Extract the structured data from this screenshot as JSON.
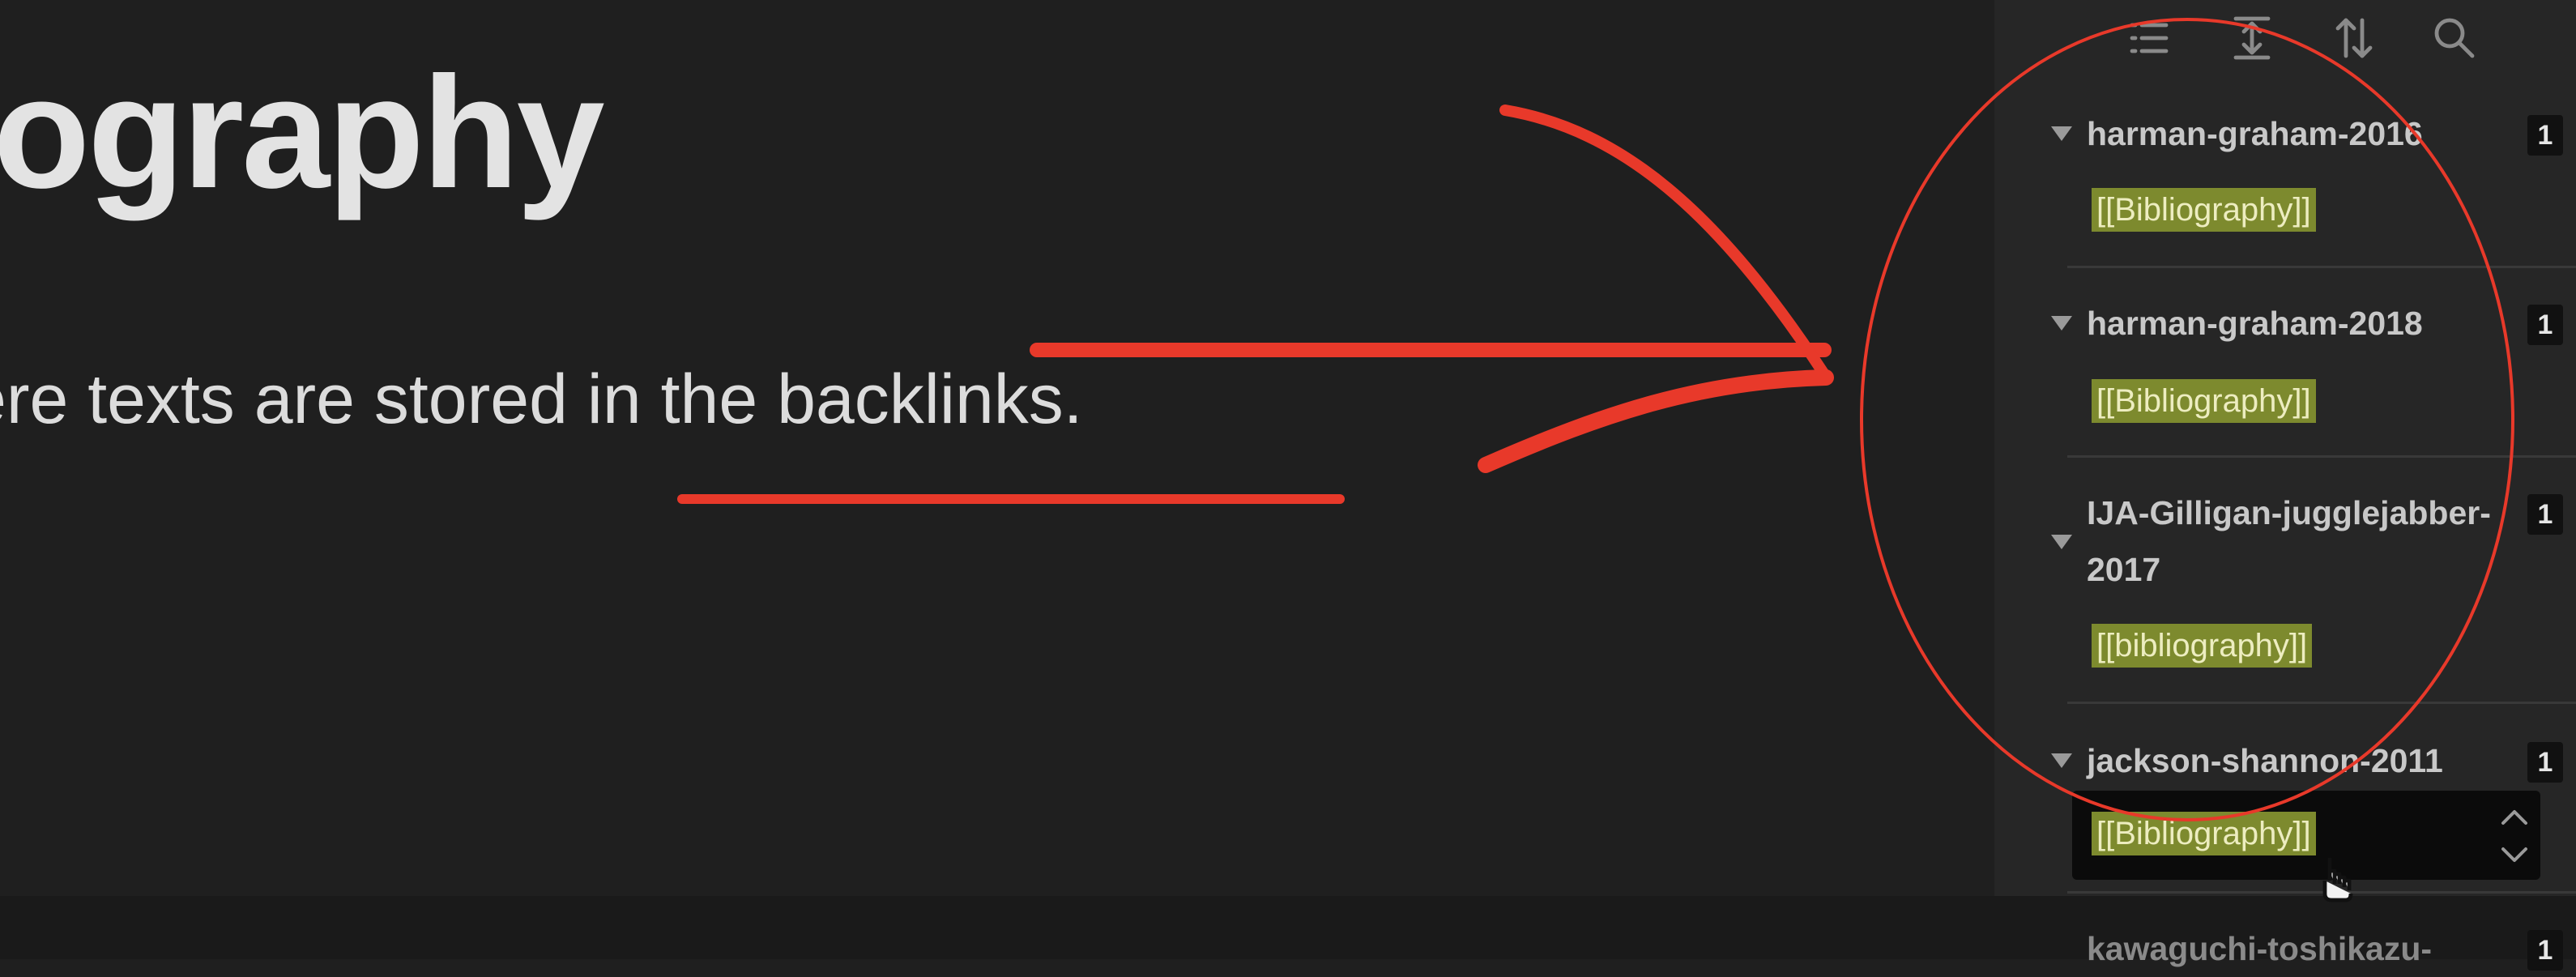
{
  "editor": {
    "title": "iography",
    "body": "ere texts are stored in the backlinks."
  },
  "toolbar": {
    "buttons": [
      {
        "icon": "list-icon"
      },
      {
        "icon": "expand-vertical-icon"
      },
      {
        "icon": "sort-icon"
      },
      {
        "icon": "search-icon"
      }
    ]
  },
  "backlinks": [
    {
      "title": "harman-graham-2016",
      "count": "1",
      "snippet": "[[Bibliography]]"
    },
    {
      "title": "harman-graham-2018",
      "count": "1",
      "snippet": "[[Bibliography]]"
    },
    {
      "title": "IJA-Gilligan-jugglejabber-2017",
      "count": "1",
      "snippet": "[[bibliography]]"
    },
    {
      "title": "jackson-shannon-2011",
      "count": "1",
      "snippet": "[[Bibliography]]"
    },
    {
      "title": "kawaguchi-toshikazu-",
      "count": "1"
    }
  ],
  "colors": {
    "annotation": "#e8392a",
    "highlight": "#7d8a2e",
    "panel_bg": "#262626",
    "editor_bg": "#1f1f1f"
  }
}
